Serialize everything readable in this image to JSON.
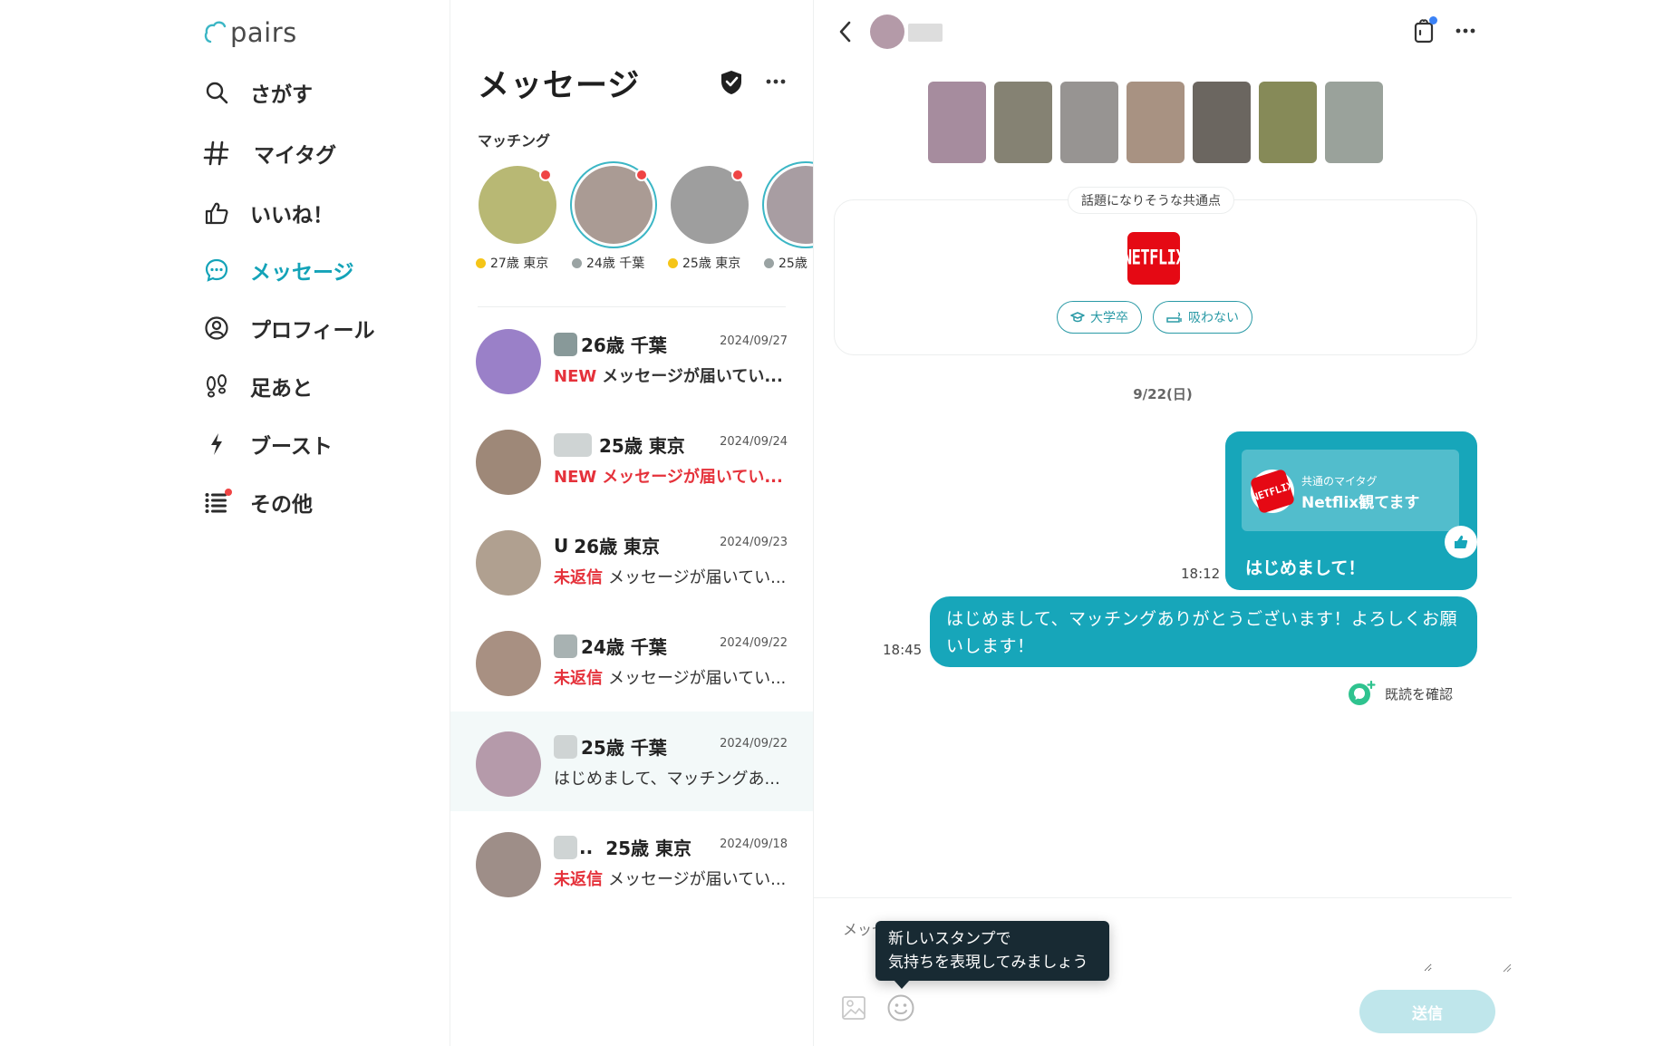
{
  "app": {
    "logo_text": "pairs"
  },
  "colors": {
    "accent": "#17a6ba",
    "alert": "#e5323b",
    "online": "#f5c518",
    "offline": "#9aa3a3"
  },
  "sidebar": {
    "items": [
      {
        "label": "さがす",
        "icon": "search-icon"
      },
      {
        "label": "マイタグ",
        "icon": "hashtag-icon"
      },
      {
        "label": "いいね！",
        "icon": "thumbs-up-icon"
      },
      {
        "label": "メッセージ",
        "icon": "chat-bubble-icon",
        "active": true
      },
      {
        "label": "プロフィール",
        "icon": "user-circle-icon"
      },
      {
        "label": "足あと",
        "icon": "footprints-icon"
      },
      {
        "label": "ブースト",
        "icon": "lightning-icon"
      },
      {
        "label": "その他",
        "icon": "list-icon",
        "badge": true
      }
    ]
  },
  "list": {
    "title": "メッセージ",
    "section_label": "マッチング",
    "matches": [
      {
        "info": "27歳 東京",
        "status": "online"
      },
      {
        "info": "24歳 千葉",
        "status": "offline"
      },
      {
        "info": "25歳 東京",
        "status": "online"
      },
      {
        "info": "25歳",
        "status": "offline"
      }
    ],
    "conversations": [
      {
        "prefix": "",
        "name": "26歳  千葉",
        "date": "2024/09/27",
        "badge": "NEW",
        "preview": "メッセージが届いてい..."
      },
      {
        "prefix": "",
        "name": "25歳  東京",
        "date": "2024/09/24",
        "badge": "NEW",
        "preview": "メッセージが届いてい..."
      },
      {
        "prefix": "U",
        "name": "26歳  東京",
        "date": "2024/09/23",
        "badge": "未返信",
        "preview": "メッセージが届いてい..."
      },
      {
        "prefix": "",
        "name": "24歳  千葉",
        "date": "2024/09/22",
        "badge": "未返信",
        "preview": "メッセージが届いてい..."
      },
      {
        "prefix": "",
        "name": "25歳  千葉",
        "date": "2024/09/22",
        "badge": "",
        "preview": "はじめまして、マッチングあ..."
      },
      {
        "prefix": "..",
        "name": "25歳  東京",
        "date": "2024/09/18",
        "badge": "未返信",
        "preview": "メッセージが届いてい..."
      }
    ]
  },
  "chat": {
    "common_title": "話題になりそうな共通点",
    "netflix_logo": "NETFLIX",
    "tags": [
      {
        "label": "大学卒",
        "icon": "graduation-cap-icon"
      },
      {
        "label": "吸わない",
        "icon": "no-smoking-icon"
      }
    ],
    "date_separator": "9/22(日)",
    "mytag_label": "共通のマイタグ",
    "mytag_text": "Netflix観てます",
    "card_message": "はじめまして！",
    "card_time": "18:12",
    "message_text": "はじめまして、マッチングありがとうございます！よろしくお願いします！",
    "message_time": "18:45",
    "read_check_label": "既読を確認",
    "composer_placeholder": "メッセージを入力",
    "tooltip_line1": "新しいスタンプで",
    "tooltip_line2": "気持ちを表現してみましょう",
    "send_label": "送信"
  }
}
